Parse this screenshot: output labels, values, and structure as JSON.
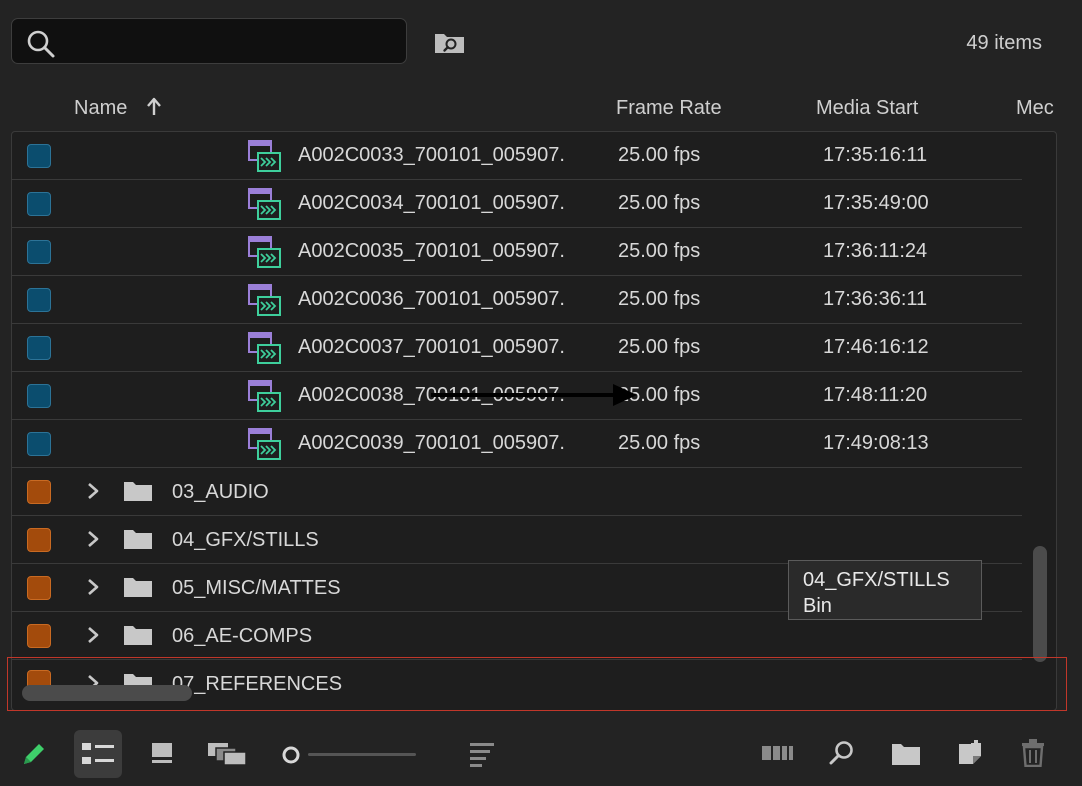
{
  "search": {
    "value": "",
    "placeholder": ""
  },
  "item_count": "49 items",
  "columns": {
    "name": "Name",
    "frame_rate": "Frame Rate",
    "media_start": "Media Start",
    "media_end_partial": "Mec"
  },
  "clips": [
    {
      "name": "A002C0033_700101_005907.",
      "frame_rate": "25.00 fps",
      "media_start": "17:35:16:11"
    },
    {
      "name": "A002C0034_700101_005907.",
      "frame_rate": "25.00 fps",
      "media_start": "17:35:49:00"
    },
    {
      "name": "A002C0035_700101_005907.",
      "frame_rate": "25.00 fps",
      "media_start": "17:36:11:24"
    },
    {
      "name": "A002C0036_700101_005907.",
      "frame_rate": "25.00 fps",
      "media_start": "17:36:36:11"
    },
    {
      "name": "A002C0037_700101_005907.",
      "frame_rate": "25.00 fps",
      "media_start": "17:46:16:12"
    },
    {
      "name": "A002C0038_700101_005907.",
      "frame_rate": "25.00 fps",
      "media_start": "17:48:11:20"
    },
    {
      "name": "A002C0039_700101_005907.",
      "frame_rate": "25.00 fps",
      "media_start": "17:49:08:13"
    }
  ],
  "bins": [
    {
      "name": "03_AUDIO"
    },
    {
      "name": "04_GFX/STILLS"
    },
    {
      "name": "05_MISC/MATTES"
    },
    {
      "name": "06_AE-COMPS"
    },
    {
      "name": "07_REFERENCES"
    }
  ],
  "tooltip": {
    "title": "04_GFX/STILLS",
    "subtitle": "Bin"
  },
  "colors": {
    "clip_label": "#0b4d6e",
    "bin_label": "#a34b0c",
    "highlight": "#c1372a",
    "clip_icon_purple": "#9b7fd8",
    "clip_icon_green": "#3ecf9c",
    "pencil_green": "#3ecf6a"
  },
  "icons": {
    "search": "search-icon",
    "find_in_bin": "find-in-folder-icon",
    "sort": "sort-ascending-arrow-icon",
    "clip": "video-clip-icon",
    "bin": "folder-icon",
    "expand": "chevron-right-icon",
    "toolbar": [
      "pencil-icon",
      "list-view-icon",
      "icon-view-icon",
      "freeform-view-icon",
      "zoom-slider",
      "sort-icons-icon",
      "automate-to-sequence-icon",
      "find-icon",
      "new-bin-icon",
      "new-item-icon",
      "trash-icon"
    ]
  }
}
